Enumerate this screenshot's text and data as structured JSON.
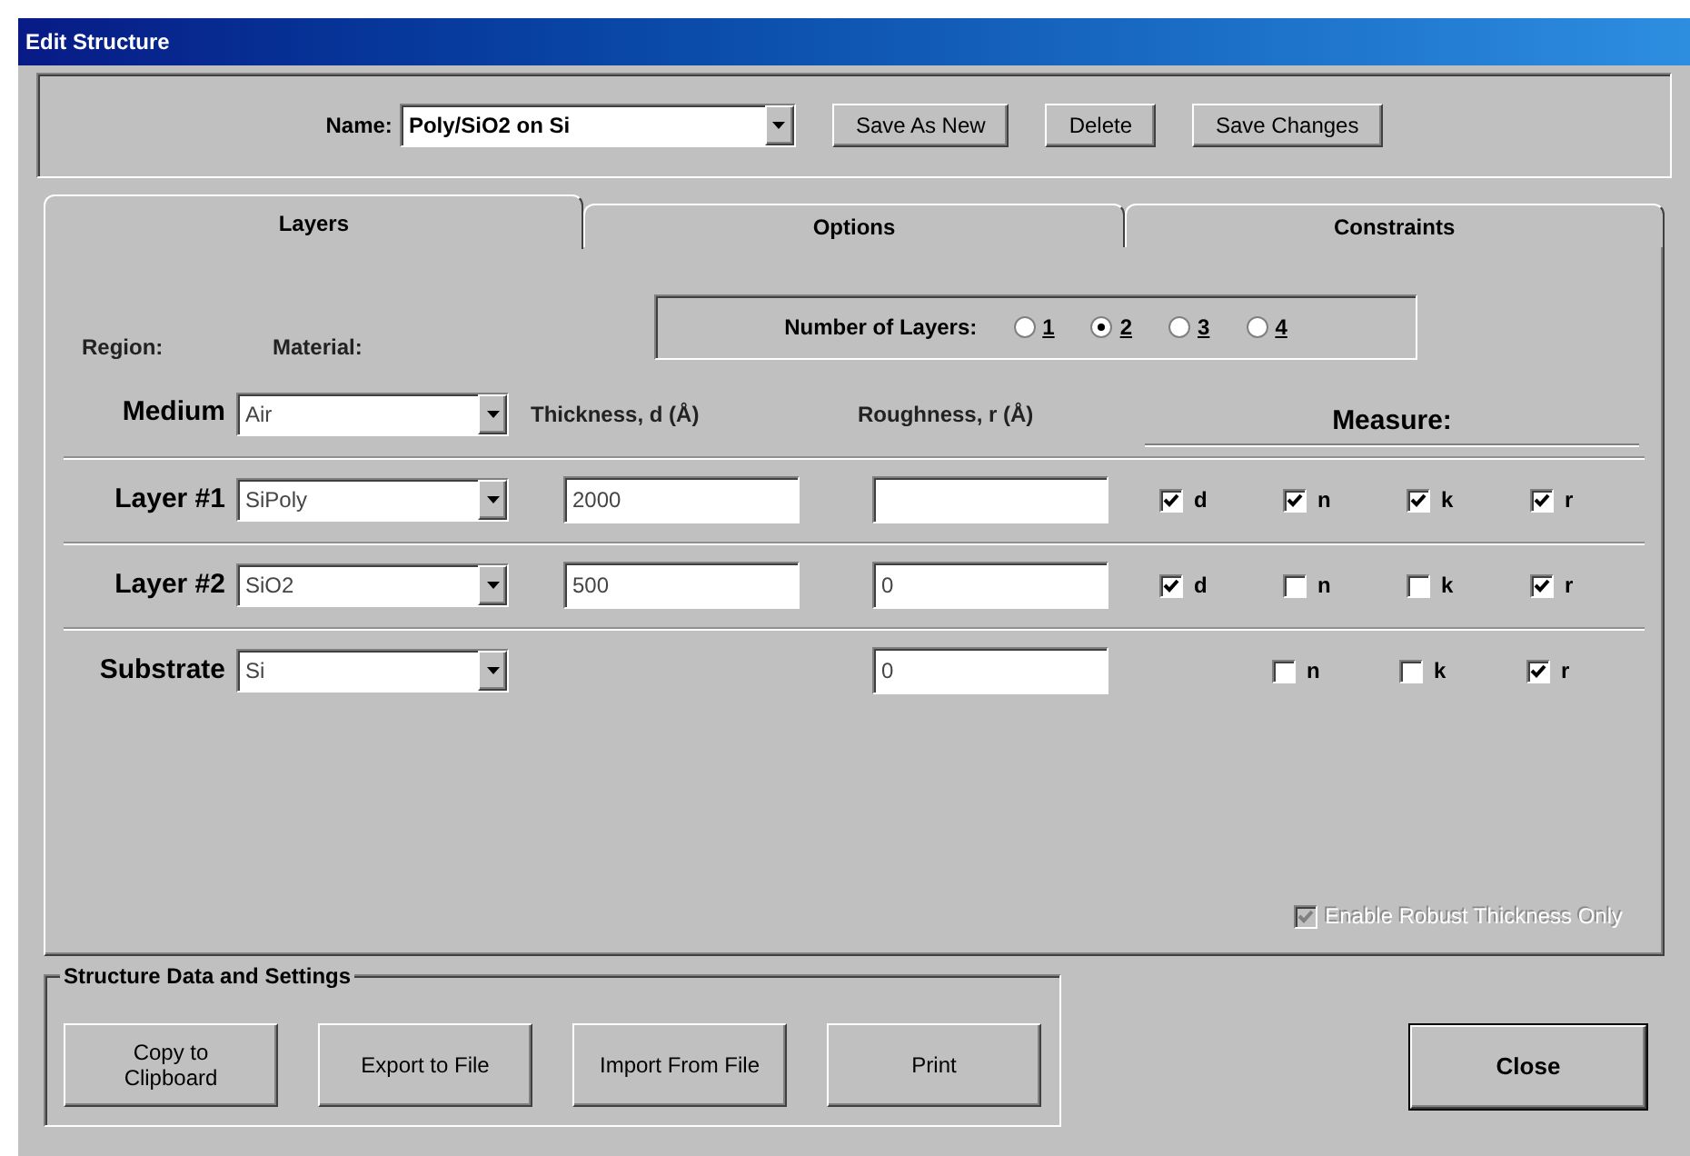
{
  "window": {
    "title": "Edit Structure"
  },
  "name_field": {
    "label": "Name:",
    "value": "Poly/SiO2 on Si"
  },
  "top_buttons": [
    "Save As New",
    "Delete",
    "Save Changes"
  ],
  "tabs": [
    {
      "label": "Layers",
      "selected": true
    },
    {
      "label": "Options",
      "selected": false
    },
    {
      "label": "Constraints",
      "selected": false
    }
  ],
  "number_of_layers": {
    "label": "Number of Layers:",
    "options": [
      {
        "label": "1",
        "selected": false
      },
      {
        "label": "2",
        "selected": true
      },
      {
        "label": "3",
        "selected": false
      },
      {
        "label": "4",
        "selected": false
      }
    ]
  },
  "headers": {
    "region": "Region:",
    "material": "Material:",
    "thickness": "Thickness, d (Å)",
    "roughness": "Roughness, r (Å)",
    "measure": "Measure:"
  },
  "rows": [
    {
      "kind": "medium",
      "region": "Medium",
      "material": "Air"
    },
    {
      "kind": "layer",
      "region": "Layer #1",
      "material": "SiPoly",
      "thickness": "2000",
      "measure": [
        {
          "label": "d",
          "checked": true
        },
        {
          "label": "n",
          "checked": true
        },
        {
          "label": "k",
          "checked": true
        },
        {
          "label": "r",
          "checked": true
        }
      ]
    },
    {
      "kind": "layer",
      "region": "Layer #2",
      "material": "SiO2",
      "thickness": "500",
      "roughness": "0",
      "measure": [
        {
          "label": "d",
          "checked": true
        },
        {
          "label": "n",
          "checked": false
        },
        {
          "label": "k",
          "checked": false
        },
        {
          "label": "r",
          "checked": true
        }
      ]
    },
    {
      "kind": "substrate",
      "region": "Substrate",
      "material": "Si",
      "roughness": "0",
      "measure": [
        {
          "label": "n",
          "checked": false
        },
        {
          "label": "k",
          "checked": false
        },
        {
          "label": "r",
          "checked": true
        }
      ]
    }
  ],
  "robust_option": {
    "label": "Enable Robust Thickness Only",
    "checked": true,
    "disabled": true
  },
  "data_group": {
    "title": "Structure Data and Settings",
    "buttons": [
      "Copy to Clipboard",
      "Export to File",
      "Import From File",
      "Print"
    ]
  },
  "close_button": "Close"
}
